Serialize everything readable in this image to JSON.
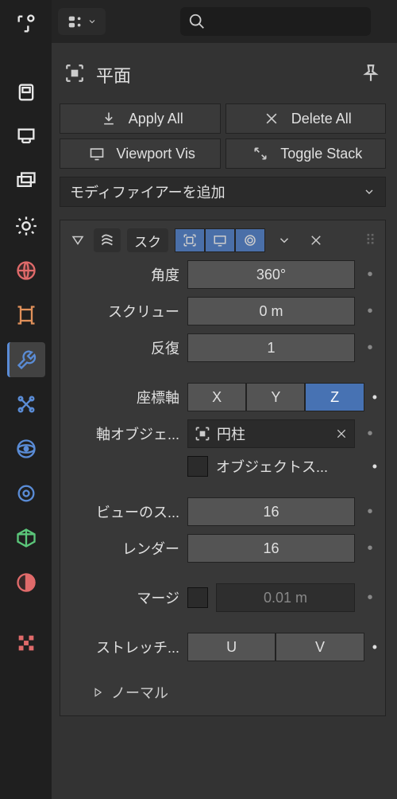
{
  "header": {
    "object_name": "平面"
  },
  "top_buttons": {
    "apply_all": "Apply All",
    "delete_all": "Delete All",
    "viewport_vis": "Viewport Vis",
    "toggle_stack": "Toggle Stack"
  },
  "add_modifier": {
    "label": "モディファイアーを追加"
  },
  "modifier": {
    "short_name": "スク",
    "angle": {
      "label": "角度",
      "value": "360°"
    },
    "screw": {
      "label": "スクリュー",
      "value": "0 m"
    },
    "iterations": {
      "label": "反復",
      "value": "1"
    },
    "axis": {
      "label": "座標軸",
      "x": "X",
      "y": "Y",
      "z": "Z",
      "active": "Z"
    },
    "axis_object": {
      "label": "軸オブジェ...",
      "value": "円柱"
    },
    "object_screw": {
      "label": "オブジェクトス..."
    },
    "view_steps": {
      "label": "ビューのス...",
      "value": "16"
    },
    "render": {
      "label": "レンダー",
      "value": "16"
    },
    "merge": {
      "label": "マージ",
      "value": "0.01 m"
    },
    "stretch": {
      "label": "ストレッチ...",
      "u": "U",
      "v": "V"
    },
    "normal_sub": "ノーマル"
  }
}
